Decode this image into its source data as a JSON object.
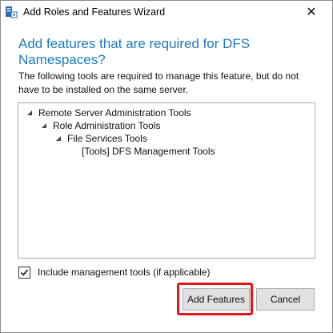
{
  "window": {
    "title": "Add Roles and Features Wizard",
    "close_glyph": "✕"
  },
  "main": {
    "heading": "Add features that are required for DFS Namespaces?",
    "description": "The following tools are required to manage this feature, but do not have to be installed on the same server."
  },
  "tree": [
    {
      "label": "Remote Server Administration Tools",
      "expanded": true
    },
    {
      "label": "Role Administration Tools",
      "expanded": true
    },
    {
      "label": "File Services Tools",
      "expanded": true
    },
    {
      "label": "[Tools] DFS Management Tools",
      "expanded": false
    }
  ],
  "include_tools": {
    "label": "Include management tools (if applicable)",
    "checked": true
  },
  "buttons": {
    "add_features": "Add Features",
    "cancel": "Cancel"
  },
  "colors": {
    "heading": "#1e7bb8",
    "highlight": "#e8141b",
    "button_bg": "#e1e1e1"
  },
  "icons": {
    "app": "server-manager-icon",
    "close": "close-icon",
    "expand": "expanded-triangle-icon",
    "check": "checkmark-icon"
  }
}
